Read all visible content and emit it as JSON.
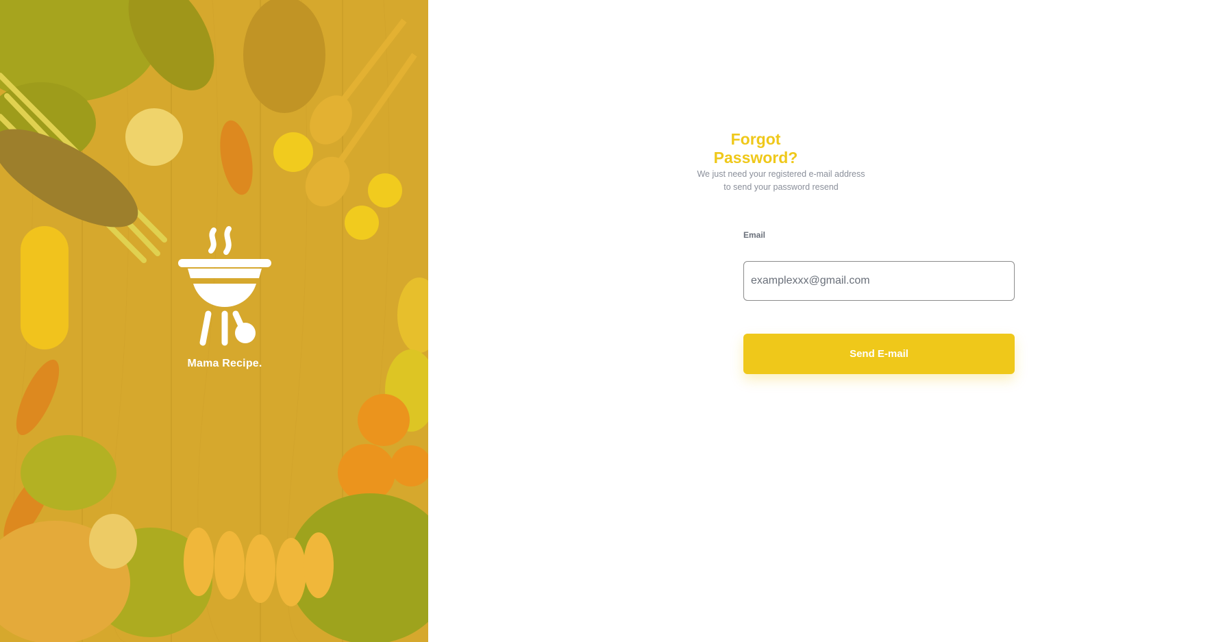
{
  "brand": {
    "name": "Mama Recipe.",
    "logo_icon": "grill-icon",
    "overlay_color": "#EFC81A"
  },
  "form": {
    "title": "Forgot Password?",
    "subtitle_line1": "We just need your registered e-mail address",
    "subtitle_line2": "to send your password resend",
    "email_label": "Email",
    "email_placeholder": "examplexxx@gmail.com",
    "email_value": "",
    "submit_label": "Send E-mail"
  },
  "colors": {
    "accent": "#EFC81A",
    "text_muted": "#696F79"
  }
}
